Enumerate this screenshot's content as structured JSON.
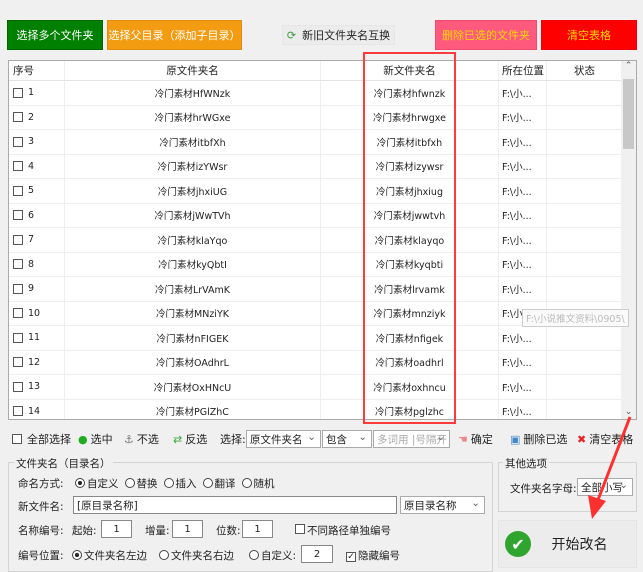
{
  "toolbar": {
    "select_multiple": "选择多个文件夹",
    "select_parent": "选择父目录（添加子目录）",
    "swap": "新旧文件夹名互换",
    "delete_selected": "删除已选的文件夹",
    "clear_table": "清空表格"
  },
  "colors": {
    "green": "#008000",
    "orange": "#f39c12",
    "pink": "#ff5a7e",
    "red": "#ff0000",
    "highlight": "#ff3b3b"
  },
  "table": {
    "headers": [
      "序号",
      "原文件夹名",
      "",
      "新文件夹名",
      "",
      "所在位置",
      "状态"
    ],
    "rows": [
      {
        "n": "1",
        "orig": "冷门素材HfWNzk",
        "new": "冷门素材hfwnzk",
        "pos": "F:\\小..."
      },
      {
        "n": "2",
        "orig": "冷门素材hrWGxe",
        "new": "冷门素材hrwgxe",
        "pos": "F:\\小..."
      },
      {
        "n": "3",
        "orig": "冷门素材itbfXh",
        "new": "冷门素材itbfxh",
        "pos": "F:\\小..."
      },
      {
        "n": "4",
        "orig": "冷门素材izYWsr",
        "new": "冷门素材izywsr",
        "pos": "F:\\小..."
      },
      {
        "n": "5",
        "orig": "冷门素材jhxiUG",
        "new": "冷门素材jhxiug",
        "pos": "F:\\小..."
      },
      {
        "n": "6",
        "orig": "冷门素材jWwTVh",
        "new": "冷门素材jwwtvh",
        "pos": "F:\\小..."
      },
      {
        "n": "7",
        "orig": "冷门素材klaYqo",
        "new": "冷门素材klayqo",
        "pos": "F:\\小..."
      },
      {
        "n": "8",
        "orig": "冷门素材kyQbtI",
        "new": "冷门素材kyqbti",
        "pos": "F:\\小..."
      },
      {
        "n": "9",
        "orig": "冷门素材LrVAmK",
        "new": "冷门素材lrvamk",
        "pos": "F:\\小..."
      },
      {
        "n": "10",
        "orig": "冷门素材MNziYK",
        "new": "冷门素材mnziyk",
        "pos": "F:\\小..."
      },
      {
        "n": "11",
        "orig": "冷门素材nFIGEK",
        "new": "冷门素材nfigek",
        "pos": "F:\\小..."
      },
      {
        "n": "12",
        "orig": "冷门素材OAdhrL",
        "new": "冷门素材oadhrl",
        "pos": "F:\\小..."
      },
      {
        "n": "13",
        "orig": "冷门素材OxHNcU",
        "new": "冷门素材oxhncu",
        "pos": "F:\\小..."
      },
      {
        "n": "14",
        "orig": "冷门素材PGlZhC",
        "new": "冷门素材pglzhc",
        "pos": "F:\\小..."
      }
    ],
    "tooltip": "F:\\小说推文资料\\0905\\"
  },
  "filter": {
    "select_all": "全部选择",
    "check": "选中",
    "uncheck": "不选",
    "invert": "反选",
    "select_label": "选择:",
    "field": "原文件夹名",
    "match": "包含",
    "keyword_placeholder": "多词用 |号隔开",
    "confirm": "确定",
    "delete_selected": "删除已选",
    "clear_table": "清空表格"
  },
  "naming": {
    "group_title": "文件夹名（目录名）",
    "mode_label": "命名方式:",
    "modes": [
      "自定义",
      "替换",
      "插入",
      "翻译",
      "随机"
    ],
    "mode_selected": "自定义",
    "new_name_label": "新文件名:",
    "new_name_value": "[原目录名称]",
    "new_name_select": "原目录名称",
    "number_label": "名称编号:",
    "start_label": "起始:",
    "start": "1",
    "step_label": "增量:",
    "step": "1",
    "digits_label": "位数:",
    "digits": "1",
    "separate_label": "不同路径单独编号",
    "separate_checked": false,
    "position_label": "编号位置:",
    "positions": [
      "文件夹名左边",
      "文件夹名右边",
      "自定义:"
    ],
    "position_selected": "文件夹名左边",
    "custom_pos": "2",
    "hide_label": "隐藏编号",
    "hide_checked": true
  },
  "other": {
    "group_title": "其他选项",
    "case_label": "文件夹名字母:",
    "case_value": "全部小写"
  },
  "start_button": "开始改名"
}
